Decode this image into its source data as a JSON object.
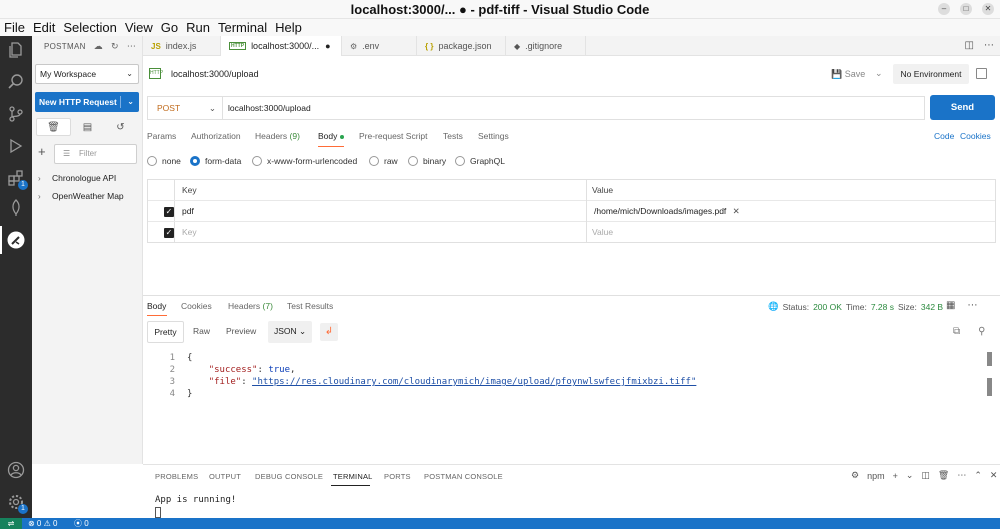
{
  "window": {
    "title": "localhost:3000/... ● - pdf-tiff - Visual Studio Code"
  },
  "menu": [
    "File",
    "Edit",
    "Selection",
    "View",
    "Go",
    "Run",
    "Terminal",
    "Help"
  ],
  "activity": {
    "extensions_badge": "1",
    "accounts_badge": "1"
  },
  "sidebar": {
    "title": "POSTMAN",
    "workspace": "My Workspace",
    "new_request": "New HTTP Request",
    "filter_placeholder": "Filter",
    "collections": [
      "Chronologue API",
      "OpenWeather Map"
    ]
  },
  "tabs": [
    {
      "icon": "JS",
      "label": "index.js"
    },
    {
      "icon": "HTTP",
      "label": "localhost:3000/..."
    },
    {
      "icon": "⚙",
      "label": ".env"
    },
    {
      "icon": "{ }",
      "label": "package.json"
    },
    {
      "icon": "◆",
      "label": ".gitignore"
    }
  ],
  "request": {
    "icon_text": "HTTP",
    "name": "localhost:3000/upload",
    "save": "Save",
    "environment": "No Environment",
    "method": "POST",
    "url": "localhost:3000/upload",
    "send": "Send",
    "tabs": {
      "params": "Params",
      "authorization": "Authorization",
      "headers": "Headers",
      "headers_count": "(9)",
      "body": "Body",
      "prerequest": "Pre-request Script",
      "tests": "Tests",
      "settings": "Settings"
    },
    "code_link": "Code",
    "cookies_link": "Cookies",
    "body_types": [
      "none",
      "form-data",
      "x-www-form-urlencoded",
      "raw",
      "binary",
      "GraphQL"
    ],
    "selected_body_type": "form-data",
    "form": {
      "key_header": "Key",
      "value_header": "Value",
      "row_key": "pdf",
      "row_value": "/home/mich/Downloads/images.pdf",
      "key_placeholder": "Key",
      "value_placeholder": "Value"
    }
  },
  "response": {
    "tabs": {
      "body": "Body",
      "cookies": "Cookies",
      "headers": "Headers",
      "headers_count": "(7)",
      "test_results": "Test Results"
    },
    "status_label": "Status:",
    "status": "200 OK",
    "time_label": "Time:",
    "time": "7.28 s",
    "size_label": "Size:",
    "size": "342 B",
    "view": {
      "pretty": "Pretty",
      "raw": "Raw",
      "preview": "Preview",
      "format": "JSON"
    },
    "lines": {
      "n1": "1",
      "n2": "2",
      "n3": "3",
      "n4": "4",
      "open": "{",
      "k1": "\"success\"",
      "v1": "true",
      "k2": "\"file\"",
      "v2": "\"https://res.cloudinary.com/cloudinarymich/image/upload/pfoynwlswfecjfmixbzi.tiff\"",
      "close": "}"
    }
  },
  "panel": {
    "tabs": [
      "PROBLEMS",
      "OUTPUT",
      "DEBUG CONSOLE",
      "TERMINAL",
      "PORTS",
      "POSTMAN CONSOLE"
    ],
    "shell": "npm",
    "terminal_output": "App is running!"
  },
  "status": {
    "problems": "⊗ 0 ⚠ 0",
    "ports": "⦿ 0"
  },
  "colors": {
    "accent": "#1a73c8",
    "postman_orange": "#ff6c37",
    "method_post": "#c06a1b",
    "success": "#2b8a3e",
    "activity_bg": "#2c2c2c"
  }
}
